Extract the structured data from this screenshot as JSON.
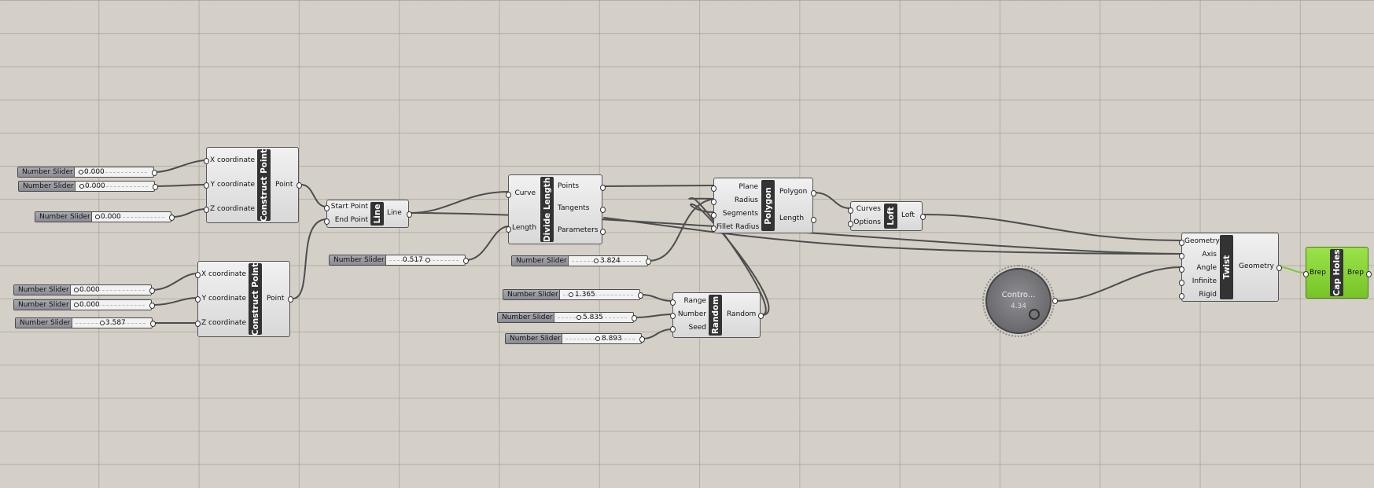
{
  "sliders": [
    {
      "name": "Number Slider",
      "value": "0.000"
    },
    {
      "name": "Number Slider",
      "value": "0.000"
    },
    {
      "name": "Number Slider",
      "value": "0.000"
    },
    {
      "name": "Number Slider",
      "value": "0.000"
    },
    {
      "name": "Number Slider",
      "value": "0.000"
    },
    {
      "name": "Number Slider",
      "value": "3.587"
    },
    {
      "name": "Number Slider",
      "value": "0.517"
    },
    {
      "name": "Number Slider",
      "value": "3.824"
    },
    {
      "name": "Number Slider",
      "value": "1.365"
    },
    {
      "name": "Number Slider",
      "value": "5.835"
    },
    {
      "name": "Number Slider",
      "value": "8.893"
    }
  ],
  "components": {
    "construct_point_1": {
      "title": "Construct Point",
      "inputs": [
        "X coordinate",
        "Y coordinate",
        "Z coordinate"
      ],
      "outputs": [
        "Point"
      ]
    },
    "construct_point_2": {
      "title": "Construct Point",
      "inputs": [
        "X coordinate",
        "Y coordinate",
        "Z coordinate"
      ],
      "outputs": [
        "Point"
      ]
    },
    "line": {
      "title": "Line",
      "inputs": [
        "Start Point",
        "End Point"
      ],
      "outputs": [
        "Line"
      ]
    },
    "divide_length": {
      "title": "Divide Length",
      "inputs": [
        "Curve",
        "Length"
      ],
      "outputs": [
        "Points",
        "Tangents",
        "Parameters"
      ]
    },
    "random": {
      "title": "Random",
      "inputs": [
        "Range",
        "Number",
        "Seed"
      ],
      "outputs": [
        "Random"
      ]
    },
    "polygon": {
      "title": "Polygon",
      "inputs": [
        "Plane",
        "Radius",
        "Segments",
        "Fillet Radius"
      ],
      "outputs": [
        "Polygon",
        "Length"
      ]
    },
    "loft": {
      "title": "Loft",
      "inputs": [
        "Curves",
        "Options"
      ],
      "outputs": [
        "Loft"
      ]
    },
    "twist": {
      "title": "Twist",
      "inputs": [
        "Geometry",
        "Axis",
        "Angle",
        "Infinite",
        "Rigid"
      ],
      "outputs": [
        "Geometry"
      ]
    },
    "cap_holes": {
      "title": "Cap Holes",
      "inputs": [
        "Brep"
      ],
      "outputs": [
        "Brep"
      ]
    }
  },
  "control_knob": {
    "label": "Contro...",
    "value": "4.34"
  },
  "colors": {
    "canvas": "#d4d0c8",
    "wire": "#4d4d4d",
    "selected_wire": "#7fc63a",
    "cap_holes": "#86d23a"
  }
}
